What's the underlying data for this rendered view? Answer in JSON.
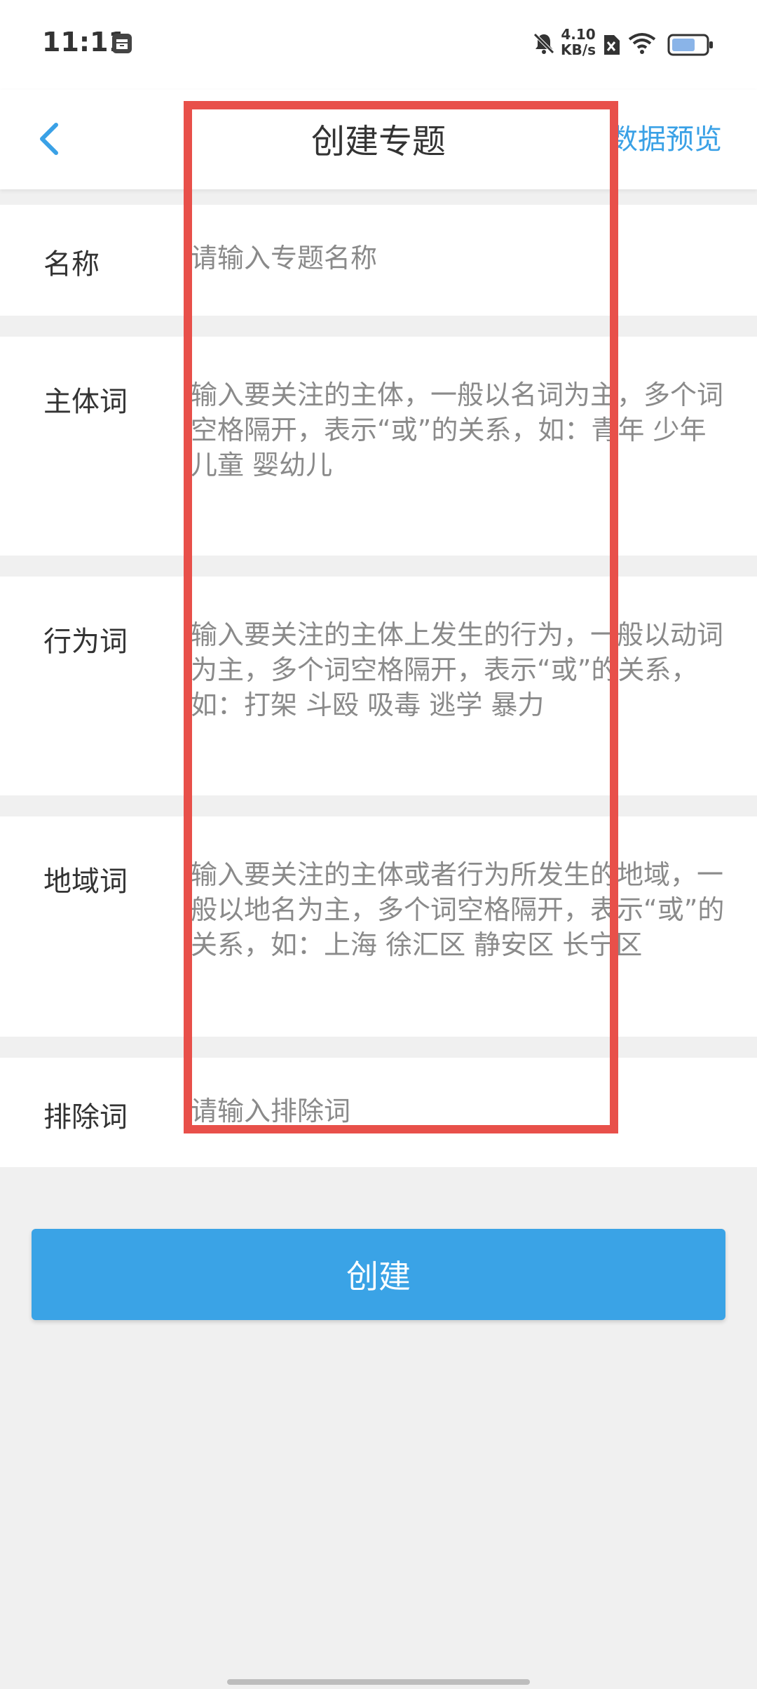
{
  "status_bar": {
    "time": "11:11",
    "network_speed_value": "4.10",
    "network_speed_unit": "KB/s"
  },
  "header": {
    "title": "创建专题",
    "right_action": "数据预览"
  },
  "form": {
    "name": {
      "label": "名称",
      "placeholder": "请输入专题名称"
    },
    "subject": {
      "label": "主体词",
      "placeholder": "输入要关注的主体，一般以名词为主，多个词空格隔开，表示“或”的关系，如：青年 少年 儿童 婴幼儿"
    },
    "behavior": {
      "label": "行为词",
      "placeholder": "输入要关注的主体上发生的行为，一般以动词为主，多个词空格隔开，表示“或”的关系，如：打架 斗殴 吸毒 逃学 暴力"
    },
    "region": {
      "label": "地域词",
      "placeholder": "输入要关注的主体或者行为所发生的地域，一般以地名为主，多个词空格隔开，表示“或”的关系，如：上海 徐汇区 静安区 长宁区"
    },
    "exclude": {
      "label": "排除词",
      "placeholder": "请输入排除词"
    }
  },
  "create_button": "创建",
  "colors": {
    "accent": "#3aa3e6",
    "annotation": "#e8504a",
    "background": "#f0f0f0"
  }
}
